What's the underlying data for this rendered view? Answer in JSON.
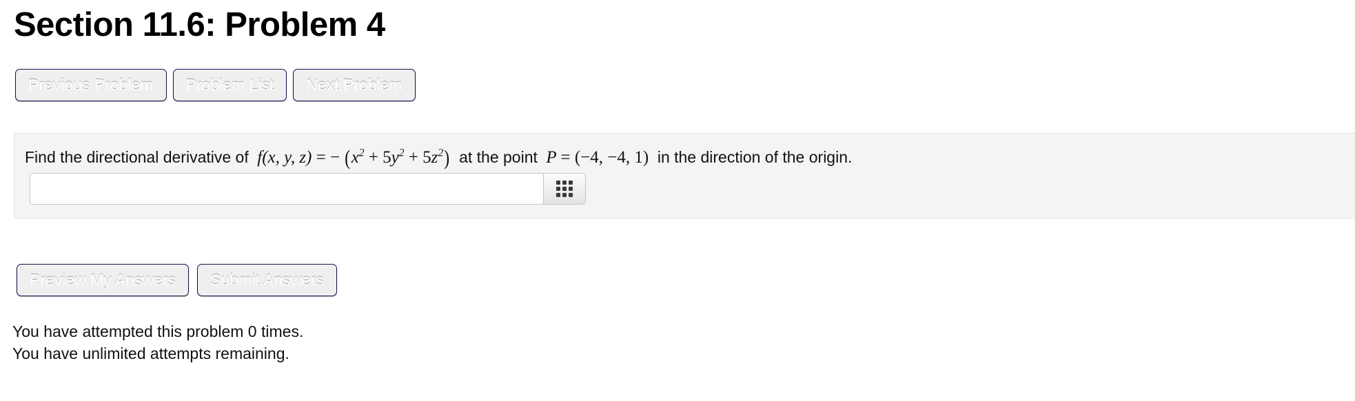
{
  "header": {
    "title": "Section 11.6: Problem 4"
  },
  "nav": {
    "previous_label": "Previous Problem",
    "list_label": "Problem List",
    "next_label": "Next Problem"
  },
  "problem": {
    "lead_text": "Find the directional derivative of",
    "function": {
      "name": "f",
      "args": "(x, y, z)",
      "equals": "=",
      "minus": "−",
      "open_paren": "(",
      "term1_base": "x",
      "term1_exp": "2",
      "plus1": "+",
      "term2_coef": "5",
      "term2_base": "y",
      "term2_exp": "2",
      "plus2": "+",
      "term3_coef": "5",
      "term3_base": "z",
      "term3_exp": "2",
      "close_paren": ")"
    },
    "mid_text": "at the point",
    "point": {
      "label": "P",
      "equals": "=",
      "value": "(−4, −4, 1)"
    },
    "tail_text": "in the direction of the origin.",
    "answer_value": "",
    "answer_placeholder": "",
    "keypad_icon": "grid-3x3-icon"
  },
  "actions": {
    "preview_label": "Preview My Answers",
    "submit_label": "Submit Answers"
  },
  "status": {
    "attempts_line": "You have attempted this problem 0 times.",
    "remaining_line": "You have unlimited attempts remaining."
  },
  "colors": {
    "button_navy": "#1d2f85",
    "panel_bg": "#f4f4f4",
    "text": "#111111"
  }
}
